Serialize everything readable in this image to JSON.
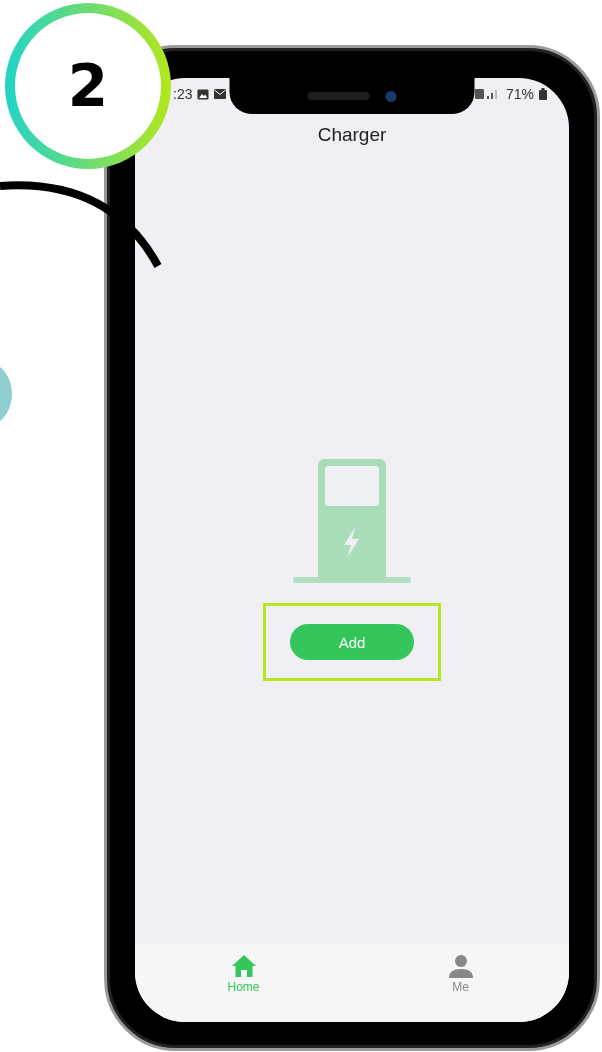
{
  "step_badge": {
    "number": "2"
  },
  "status_bar": {
    "time": ":23",
    "battery": "71%"
  },
  "header": {
    "title": "Charger"
  },
  "empty_state": {
    "button": "Add",
    "highlighted": true
  },
  "tab_bar": {
    "tabs": [
      {
        "label": "Home",
        "kind": "home",
        "selected": true
      },
      {
        "label": "Me",
        "kind": "person",
        "selected": false
      }
    ]
  }
}
